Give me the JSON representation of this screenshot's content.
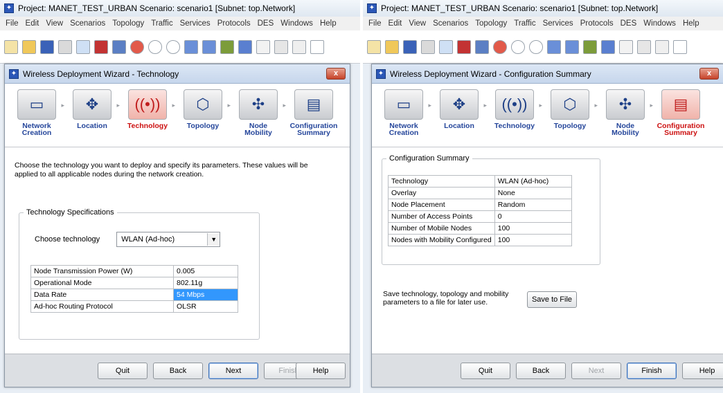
{
  "left": {
    "app_title": "Project: MANET_TEST_URBAN Scenario: scenario1  [Subnet: top.Network]",
    "menu": [
      "File",
      "Edit",
      "View",
      "Scenarios",
      "Topology",
      "Traffic",
      "Services",
      "Protocols",
      "DES",
      "Windows",
      "Help"
    ],
    "wizard_title": "Wireless Deployment Wizard - Technology",
    "close_label": "x",
    "steps": [
      {
        "line1": "Network",
        "line2": "Creation",
        "icon": "network-icon"
      },
      {
        "line1": "Location",
        "line2": "",
        "icon": "location-icon"
      },
      {
        "line1": "Technology",
        "line2": "",
        "icon": "antenna-icon"
      },
      {
        "line1": "Topology",
        "line2": "",
        "icon": "topology-icon"
      },
      {
        "line1": "Node",
        "line2": "Mobility",
        "icon": "mobility-icon"
      },
      {
        "line1": "Configuration",
        "line2": "Summary",
        "icon": "document-icon"
      }
    ],
    "active_step": 2,
    "intro": "Choose the technology you want to deploy and specify its parameters. These values will be applied to all applicable nodes during the network creation.",
    "group_label": "Technology Specifications",
    "choose_label": "Choose technology",
    "choose_value": "WLAN (Ad-hoc)",
    "params": [
      {
        "name": "Node Transmission Power (W)",
        "value": "0.005"
      },
      {
        "name": "Operational Mode",
        "value": "802.11g"
      },
      {
        "name": "Data Rate",
        "value": "54 Mbps"
      },
      {
        "name": "Ad-hoc Routing Protocol",
        "value": "OLSR"
      }
    ],
    "buttons": {
      "quit": "Quit",
      "back": "Back",
      "next": "Next",
      "finish": "Finish",
      "help": "Help"
    }
  },
  "right": {
    "app_title": "Project: MANET_TEST_URBAN Scenario: scenario1  [Subnet: top.Network]",
    "menu": [
      "File",
      "Edit",
      "View",
      "Scenarios",
      "Topology",
      "Traffic",
      "Services",
      "Protocols",
      "DES",
      "Windows",
      "Help"
    ],
    "wizard_title": "Wireless Deployment Wizard - Configuration Summary",
    "close_label": "x",
    "steps": [
      {
        "line1": "Network",
        "line2": "Creation",
        "icon": "network-icon"
      },
      {
        "line1": "Location",
        "line2": "",
        "icon": "location-icon"
      },
      {
        "line1": "Technology",
        "line2": "",
        "icon": "antenna-icon"
      },
      {
        "line1": "Topology",
        "line2": "",
        "icon": "topology-icon"
      },
      {
        "line1": "Node",
        "line2": "Mobility",
        "icon": "mobility-icon"
      },
      {
        "line1": "Configuration",
        "line2": "Summary",
        "icon": "document-icon"
      }
    ],
    "active_step": 5,
    "group_label": "Configuration Summary",
    "summary": [
      {
        "name": "Technology",
        "value": "WLAN (Ad-hoc)"
      },
      {
        "name": "Overlay",
        "value": "None"
      },
      {
        "name": "Node Placement",
        "value": "Random"
      },
      {
        "name": "Number of Access Points",
        "value": "0"
      },
      {
        "name": "Number of Mobile Nodes",
        "value": "100"
      },
      {
        "name": "Nodes with Mobility Configured",
        "value": "100"
      }
    ],
    "save_text": "Save technology, topology and mobility parameters to a file for later use.",
    "save_button": "Save to File",
    "buttons": {
      "quit": "Quit",
      "back": "Back",
      "next": "Next",
      "finish": "Finish",
      "help": "Help"
    }
  },
  "colors": {
    "accent": "#24459a",
    "active": "#cc1010",
    "selection": "#3297fd"
  }
}
